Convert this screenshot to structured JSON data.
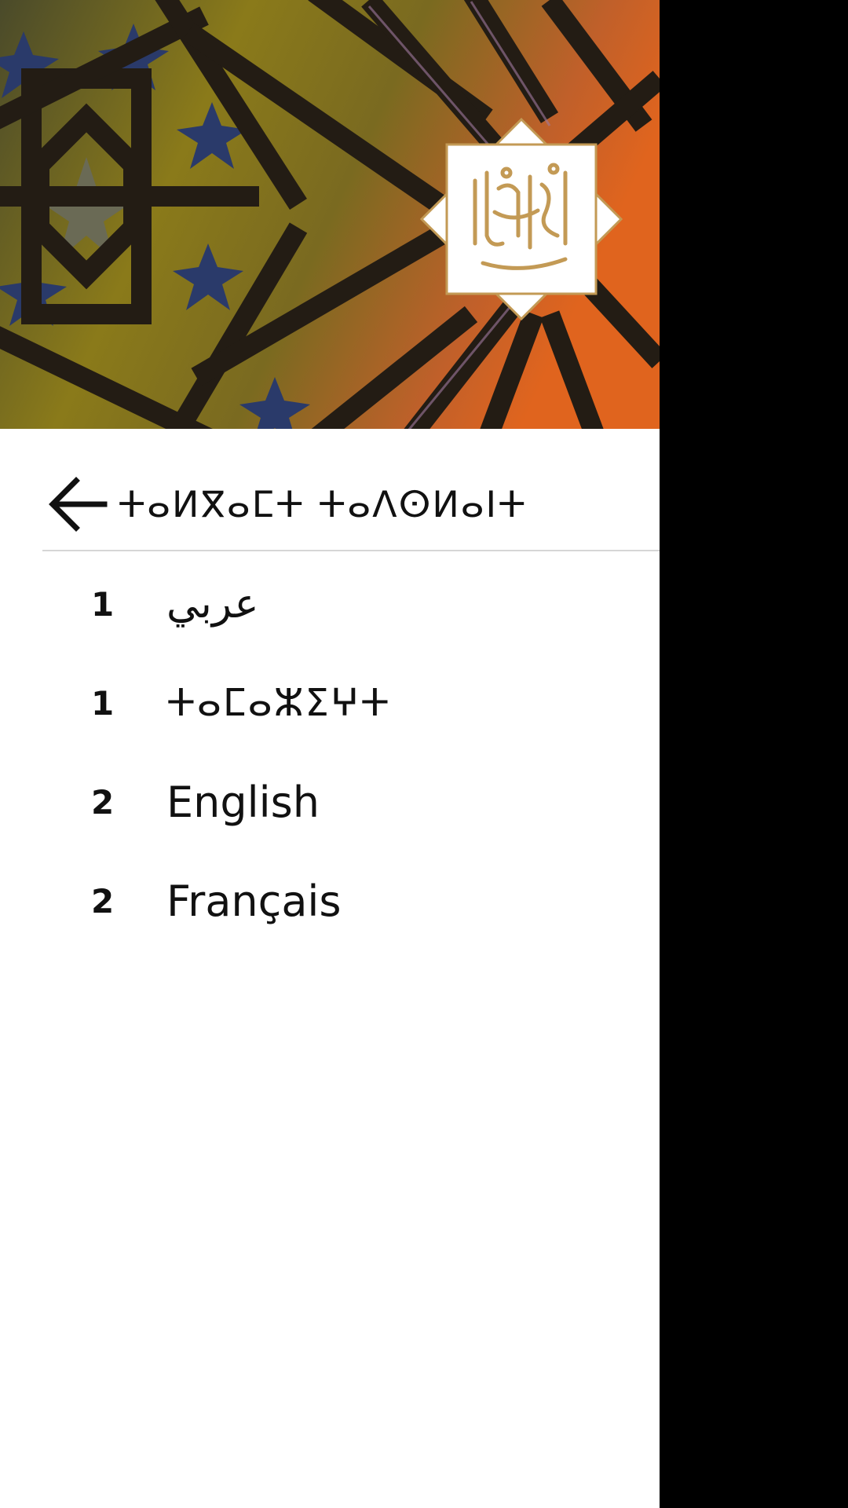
{
  "drawer": {
    "title": "ⵜⴰⵍⴳⴰⵎⵜ ⵜⴰⴷⵙⵍⴰⵏⵜ",
    "back_icon": "arrow-left-icon",
    "header_logo": "quran-calligraphy-logo"
  },
  "languages": [
    {
      "number": "1",
      "label": "عربي"
    },
    {
      "number": "1",
      "label": "ⵜⴰⵎⴰⵣⵉⵖⵜ"
    },
    {
      "number": "2",
      "label": "English"
    },
    {
      "number": "2",
      "label": "Français"
    }
  ],
  "colors": {
    "drawer_bg": "#ffffff",
    "scrim": "#000000",
    "text": "#111111",
    "divider": "#d6d6d6",
    "logo_gold": "#c39a55"
  }
}
